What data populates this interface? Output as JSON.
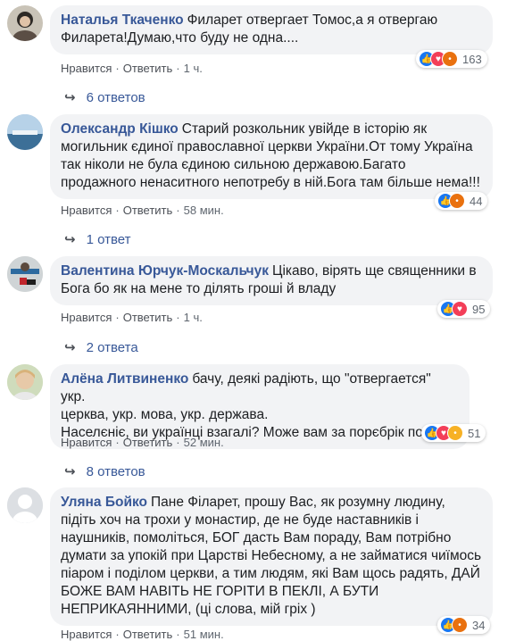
{
  "comments": [
    {
      "author": "Наталья Ткаченко",
      "lines": [
        "Филарет отвергает Томос,а я отвергаю",
        "Филарета!Думаю,что буду не одна...."
      ],
      "like": "Нравится",
      "reply": "Ответить",
      "time": "1 ч.",
      "reactions": [
        "like",
        "love",
        "angry"
      ],
      "reaction_count": "163",
      "replies": "6 ответов"
    },
    {
      "author": "Олександр Кішко",
      "lines": [
        "Старий розкольник увійде в історію як",
        "могильник єдиної православної церкви України.От тому Україна",
        "так ніколи не була єдиною сильною державою.Багато",
        "продажного ненаситного непотребу в ній.Бога там більше нема!!!"
      ],
      "like": "Нравится",
      "reply": "Ответить",
      "time": "58 мин.",
      "reactions": [
        "like",
        "angry"
      ],
      "reaction_count": "44",
      "replies": "1 ответ"
    },
    {
      "author": "Валентина Юрчук-Москальчук",
      "lines": [
        "Цікаво, вірять ще священники в",
        "Бога бо як на мене то ділять гроші й владу"
      ],
      "like": "Нравится",
      "reply": "Ответить",
      "time": "1 ч.",
      "reactions": [
        "like",
        "love"
      ],
      "reaction_count": "95",
      "replies": "2 ответа"
    },
    {
      "author": "Алёна Литвиненко",
      "lines": [
        "бачу, деякі радіють, що \"отвергается\" укр.",
        "церква, укр. мова, укр. держава.",
        "Населєніє, ви українці взагалі? Може вам за порєбрік пора?"
      ],
      "like": "Нравится",
      "reply": "Ответить",
      "time": "52 мин.",
      "reactions": [
        "like",
        "love",
        "sad"
      ],
      "reaction_count": "51",
      "replies": "8 ответов"
    },
    {
      "author": "Уляна Бойко",
      "lines": [
        "Пане Філарет, прошу Вас, як розумну людину,",
        "підіть хоч на трохи у монастир, де не буде наставників і",
        "наушників, помоліться, БОГ дасть Вам пораду, Вам потрібно",
        "думати за упокій при Царстві Небесному, а не займатися чиїмось",
        "піаром і поділом церкви, а тим людям, які Вам щось радять, ДАЙ",
        "БОЖЕ ВАМ НАВІТЬ НЕ ГОРІТИ В ПЕКЛІ, А БУТИ",
        "НЕПРИКАЯННИМИ, (ці слова, мій гріх )"
      ],
      "like": "Нравится",
      "reply": "Ответить",
      "time": "51 мин.",
      "reactions": [
        "like",
        "angry"
      ],
      "reaction_count": "34",
      "replies": ""
    }
  ],
  "colors": {
    "author": "#385898",
    "bubble": "#f2f3f5",
    "like": "#1877f2",
    "love": "#f33e58",
    "angry": "#e9710f",
    "sad": "#f7b125"
  }
}
